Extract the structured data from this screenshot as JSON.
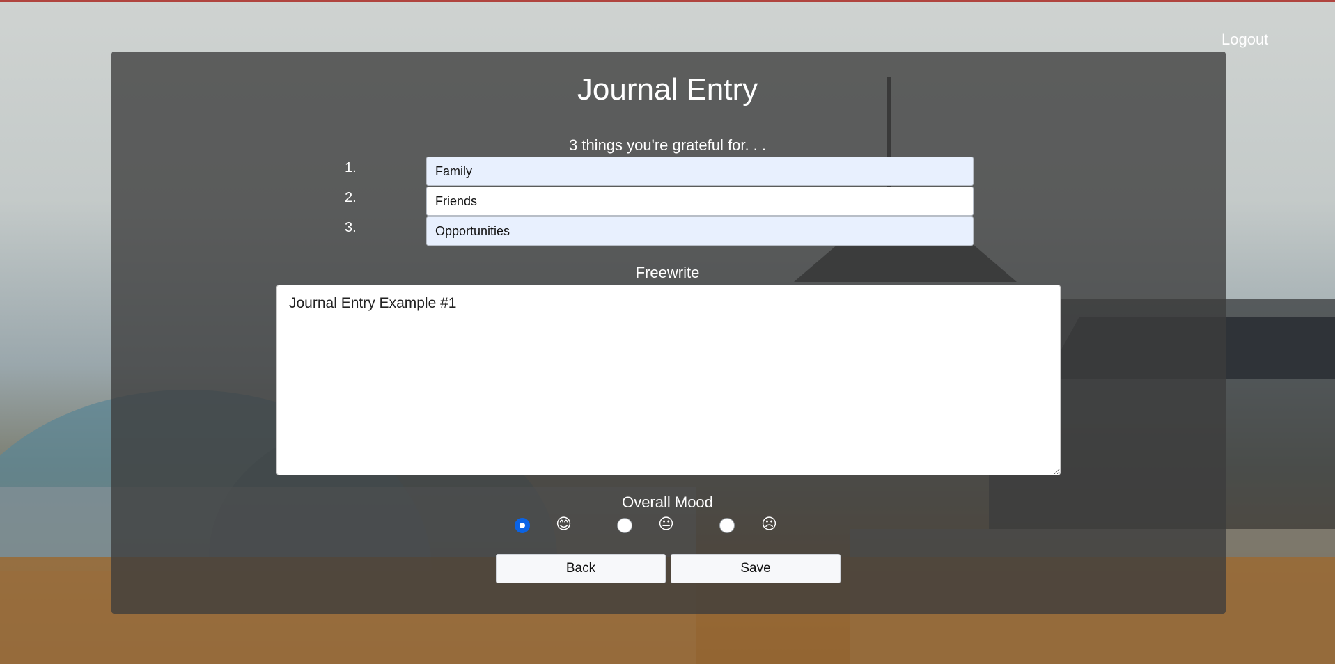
{
  "header": {
    "logout_label": "Logout"
  },
  "page": {
    "title": "Journal Entry",
    "gratitude_prompt": "3 things you're grateful for. . .",
    "gratitude": [
      {
        "number": "1.",
        "value": "Family"
      },
      {
        "number": "2.",
        "value": "Friends"
      },
      {
        "number": "3.",
        "value": "Opportunities"
      }
    ],
    "freewrite_label": "Freewrite",
    "freewrite_text": "Journal Entry Example #1",
    "mood_label": "Overall Mood",
    "mood_options": [
      {
        "name": "happy",
        "icon": "smile-icon",
        "glyph": "😊",
        "selected": true
      },
      {
        "name": "neutral",
        "icon": "neutral-face-icon",
        "glyph": "😐",
        "selected": false
      },
      {
        "name": "sad",
        "icon": "frown-icon",
        "glyph": "☹",
        "selected": false
      }
    ],
    "back_label": "Back",
    "save_label": "Save"
  },
  "colors": {
    "panel": "#3c3c3c",
    "radio_selected": "#0b63e5",
    "autofill_input": "#e8f0fe",
    "top_border": "#b0453f"
  }
}
